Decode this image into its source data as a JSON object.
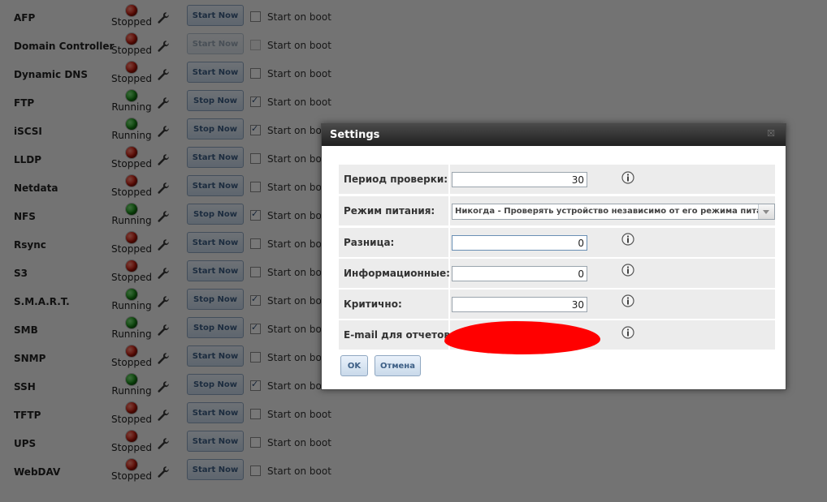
{
  "services": [
    {
      "name": "AFP",
      "status": "Stopped",
      "status_color": "red",
      "action": "Start Now",
      "boot_label": "Start on boot",
      "boot_checked": false,
      "disabled": false
    },
    {
      "name": "Domain Controller",
      "status": "Stopped",
      "status_color": "red",
      "action": "Start Now",
      "boot_label": "Start on boot",
      "boot_checked": false,
      "disabled": true
    },
    {
      "name": "Dynamic DNS",
      "status": "Stopped",
      "status_color": "red",
      "action": "Start Now",
      "boot_label": "Start on boot",
      "boot_checked": false,
      "disabled": false
    },
    {
      "name": "FTP",
      "status": "Running",
      "status_color": "green",
      "action": "Stop Now",
      "boot_label": "Start on boot",
      "boot_checked": true,
      "disabled": false
    },
    {
      "name": "iSCSI",
      "status": "Running",
      "status_color": "green",
      "action": "Stop Now",
      "boot_label": "Start on boot",
      "boot_checked": true,
      "disabled": false
    },
    {
      "name": "LLDP",
      "status": "Stopped",
      "status_color": "red",
      "action": "Start Now",
      "boot_label": "Start on boot",
      "boot_checked": false,
      "disabled": false
    },
    {
      "name": "Netdata",
      "status": "Stopped",
      "status_color": "red",
      "action": "Start Now",
      "boot_label": "Start on boot",
      "boot_checked": false,
      "disabled": false
    },
    {
      "name": "NFS",
      "status": "Running",
      "status_color": "green",
      "action": "Stop Now",
      "boot_label": "Start on boot",
      "boot_checked": true,
      "disabled": false
    },
    {
      "name": "Rsync",
      "status": "Stopped",
      "status_color": "red",
      "action": "Start Now",
      "boot_label": "Start on boot",
      "boot_checked": false,
      "disabled": false
    },
    {
      "name": "S3",
      "status": "Stopped",
      "status_color": "red",
      "action": "Start Now",
      "boot_label": "Start on boot",
      "boot_checked": false,
      "disabled": false
    },
    {
      "name": "S.M.A.R.T.",
      "status": "Running",
      "status_color": "green",
      "action": "Stop Now",
      "boot_label": "Start on boot",
      "boot_checked": true,
      "disabled": false
    },
    {
      "name": "SMB",
      "status": "Running",
      "status_color": "green",
      "action": "Stop Now",
      "boot_label": "Start on boot",
      "boot_checked": true,
      "disabled": false
    },
    {
      "name": "SNMP",
      "status": "Stopped",
      "status_color": "red",
      "action": "Start Now",
      "boot_label": "Start on boot",
      "boot_checked": false,
      "disabled": false
    },
    {
      "name": "SSH",
      "status": "Running",
      "status_color": "green",
      "action": "Stop Now",
      "boot_label": "Start on boot",
      "boot_checked": true,
      "disabled": false
    },
    {
      "name": "TFTP",
      "status": "Stopped",
      "status_color": "red",
      "action": "Start Now",
      "boot_label": "Start on boot",
      "boot_checked": false,
      "disabled": false
    },
    {
      "name": "UPS",
      "status": "Stopped",
      "status_color": "red",
      "action": "Start Now",
      "boot_label": "Start on boot",
      "boot_checked": false,
      "disabled": false
    },
    {
      "name": "WebDAV",
      "status": "Stopped",
      "status_color": "red",
      "action": "Start Now",
      "boot_label": "Start on boot",
      "boot_checked": false,
      "disabled": false
    }
  ],
  "dialog": {
    "title": "Settings",
    "close_glyph": "☒",
    "fields": {
      "check_period": {
        "label": "Период проверки:",
        "value": "30"
      },
      "power_mode": {
        "label": "Режим питания:",
        "value": "Никогда - Проверять устройство независимо от его режима питания"
      },
      "difference": {
        "label": "Разница:",
        "value": "0"
      },
      "informational": {
        "label": "Информационные:",
        "value": "0"
      },
      "critical": {
        "label": "Критично:",
        "value": "30"
      },
      "email": {
        "label": "E-mail для отчетов:"
      }
    },
    "ok_label": "OK",
    "cancel_label": "Отмена"
  },
  "colors": {
    "overlay": "#000000",
    "title_bar": "#2a2a2a",
    "button_text": "#3d5f86",
    "redaction": "#ff0000"
  },
  "icons": [
    "wrench-icon",
    "info-icon",
    "close-icon",
    "chevron-down-icon",
    "status-dot-icon"
  ]
}
